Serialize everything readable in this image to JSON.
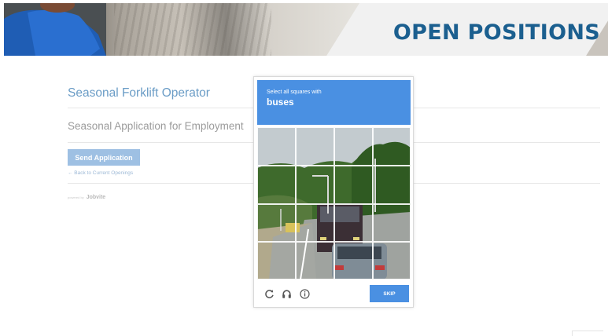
{
  "banner": {
    "title": "OPEN POSITIONS"
  },
  "job": {
    "title": "Seasonal Forklift Operator",
    "form_title": "Seasonal Application for Employment",
    "send_label": "Send Application",
    "back_link": "← Back to Current Openings",
    "powered_by": "powered by",
    "powered_brand": "Jobvite"
  },
  "captcha": {
    "instruction": "Select all squares with",
    "target": "buses",
    "skip_label": "SKIP",
    "icons": [
      "reload-icon",
      "audio-icon",
      "info-icon"
    ],
    "grid_rows": 4,
    "grid_cols": 4
  },
  "colors": {
    "banner_title": "#1b5f8f",
    "accent_green": "#6db33f",
    "captcha_blue": "#4a90e2",
    "link_blue": "#6a9cc6"
  }
}
